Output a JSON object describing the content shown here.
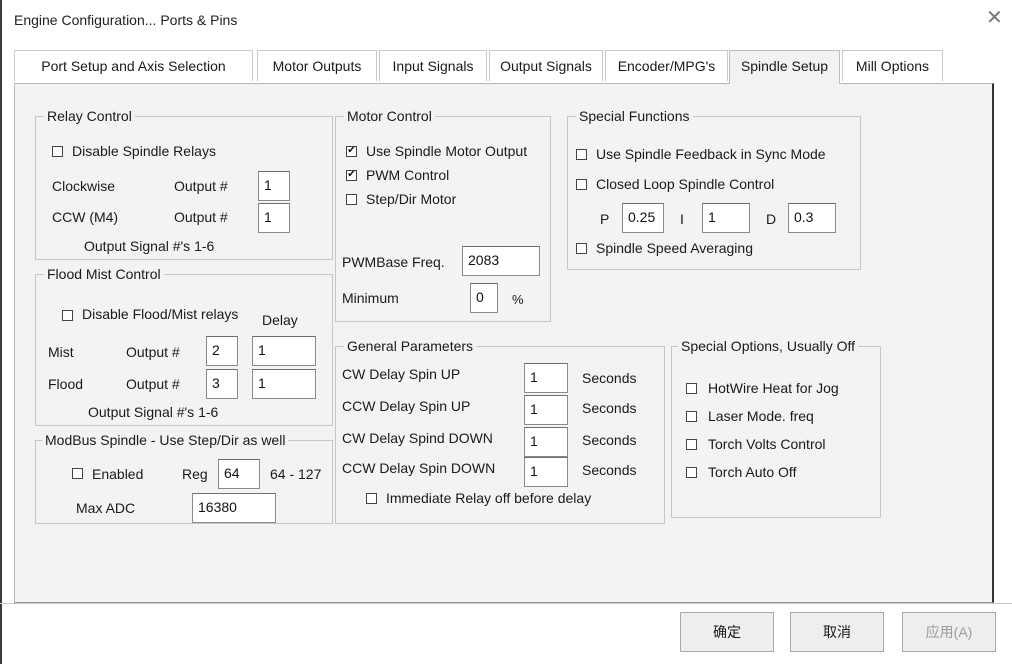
{
  "window": {
    "title": "Engine Configuration... Ports & Pins",
    "close_icon": "close-icon"
  },
  "tabs": [
    {
      "label": "Port Setup and Axis Selection"
    },
    {
      "label": "Motor Outputs"
    },
    {
      "label": "Input Signals"
    },
    {
      "label": "Output Signals"
    },
    {
      "label": "Encoder/MPG's"
    },
    {
      "label": "Spindle Setup",
      "active": true
    },
    {
      "label": "Mill Options"
    }
  ],
  "relay": {
    "title": "Relay Control",
    "disable_label": "Disable Spindle Relays",
    "disable_checked": false,
    "cw_label": "Clockwise",
    "cw_output_label": "Output #",
    "cw_output": "1",
    "ccw_label": "CCW (M4)",
    "ccw_output_label": "Output #",
    "ccw_output": "1",
    "note": "Output Signal #'s 1-6"
  },
  "flood": {
    "title": "Flood Mist Control",
    "disable_label": "Disable Flood/Mist relays",
    "disable_checked": false,
    "delay_label": "Delay",
    "mist_label": "Mist",
    "mist_output_label": "Output #",
    "mist_output": "2",
    "mist_delay": "1",
    "flood_label": "Flood",
    "flood_output_label": "Output #",
    "flood_output": "3",
    "flood_delay": "1",
    "note": "Output Signal #'s 1-6"
  },
  "modbus": {
    "title": "ModBus Spindle - Use Step/Dir as well",
    "enabled_label": "Enabled",
    "enabled_checked": false,
    "reg_label": "Reg",
    "reg_value": "64",
    "reg_range": "64 - 127",
    "maxadc_label": "Max ADC",
    "maxadc_value": "16380"
  },
  "motor": {
    "title": "Motor Control",
    "use_spindle_label": "Use Spindle Motor Output",
    "use_spindle_checked": true,
    "pwm_label": "PWM Control",
    "pwm_checked": true,
    "stepdir_label": "Step/Dir Motor",
    "stepdir_checked": false,
    "pwmbase_label": "PWMBase Freq.",
    "pwmbase_value": "2083",
    "minimum_label": "Minimum",
    "minimum_value": "0",
    "minimum_unit": "%"
  },
  "special": {
    "title": "Special Functions",
    "feedback_label": "Use Spindle Feedback in Sync Mode",
    "feedback_checked": false,
    "closedloop_label": "Closed Loop Spindle Control",
    "closedloop_checked": false,
    "p_label": "P",
    "p_value": "0.25",
    "i_label": "I",
    "i_value": "1",
    "d_label": "D",
    "d_value": "0.3",
    "averaging_label": "Spindle Speed Averaging",
    "averaging_checked": false
  },
  "general": {
    "title": "General Parameters",
    "cw_up_label": "CW Delay Spin UP",
    "cw_up_value": "1",
    "ccw_up_label": "CCW Delay Spin UP",
    "ccw_up_value": "1",
    "cw_down_label": "CW Delay Spind DOWN",
    "cw_down_value": "1",
    "ccw_down_label": "CCW Delay Spin DOWN",
    "ccw_down_value": "1",
    "seconds_label": "Seconds",
    "immediate_label": "Immediate Relay off before delay",
    "immediate_checked": false
  },
  "options": {
    "title": "Special Options, Usually Off",
    "hotwire_label": "HotWire Heat for Jog",
    "hotwire_checked": false,
    "laser_label": "Laser Mode. freq",
    "laser_checked": false,
    "torchvolts_label": "Torch Volts Control",
    "torchvolts_checked": false,
    "torchoff_label": "Torch Auto Off",
    "torchoff_checked": false
  },
  "buttons": {
    "ok": "确定",
    "cancel": "取消",
    "apply": "应用(A)"
  }
}
